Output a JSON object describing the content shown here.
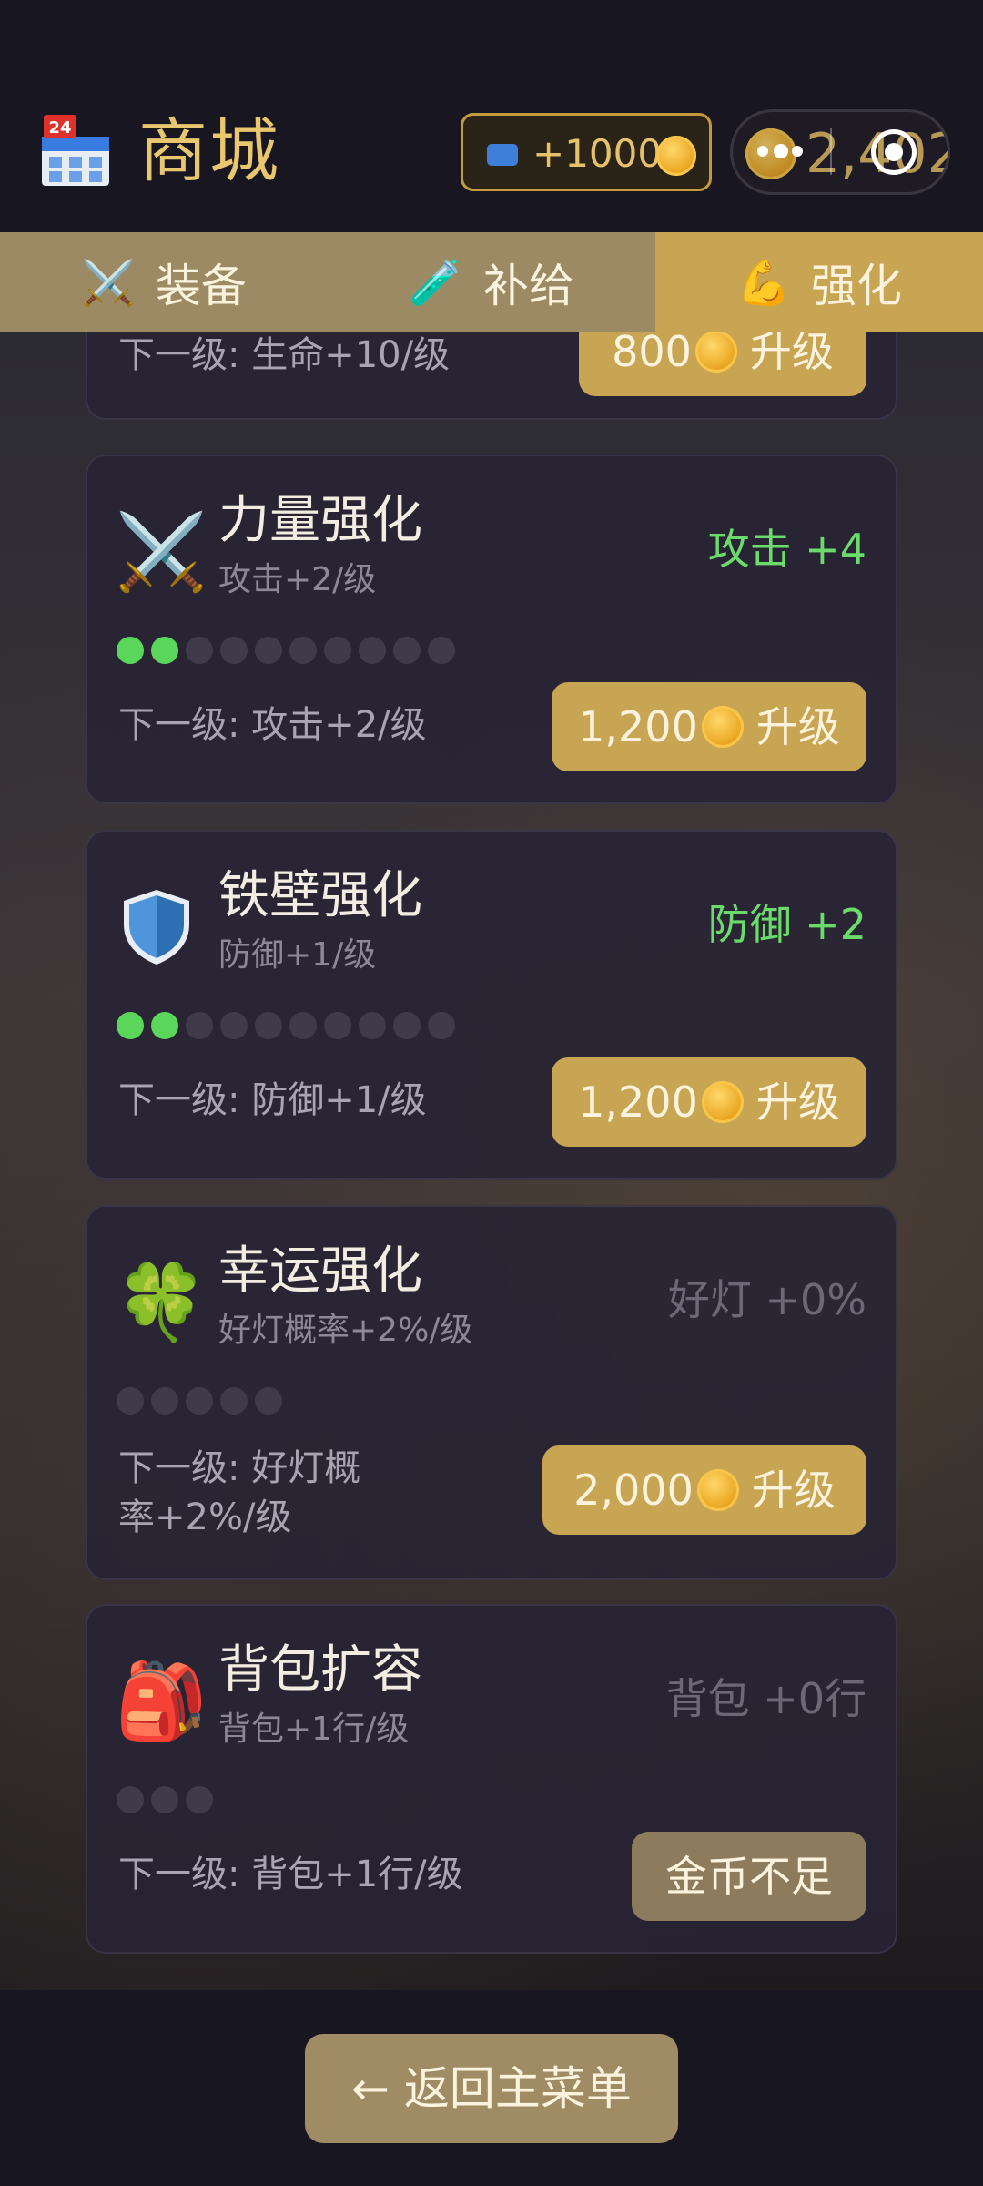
{
  "header": {
    "shop_icon": "convenience-store-icon",
    "title": "商城",
    "ad_reward": "+1000",
    "coins": "2,402"
  },
  "tabs": [
    {
      "icon": "⚔️",
      "label": "装备",
      "active": false
    },
    {
      "icon": "🧪",
      "label": "补给",
      "active": false
    },
    {
      "icon": "💪",
      "label": "强化",
      "active": true
    }
  ],
  "partial_card": {
    "next": "下一级: 生命+10/级",
    "price": "800",
    "action": "升级"
  },
  "cards": [
    {
      "icon": "⚔️",
      "name": "力量强化",
      "sub": "攻击+2/级",
      "stat": "攻击 +4",
      "stat_color": "#6bdc6b",
      "level": 2,
      "max_level": 10,
      "next": "下一级: 攻击+2/级",
      "price": "1,200",
      "action": "升级"
    },
    {
      "icon": "shield-icon",
      "name": "铁壁强化",
      "sub": "防御+1/级",
      "stat": "防御 +2",
      "stat_color": "#6bdc6b",
      "level": 2,
      "max_level": 10,
      "next": "下一级: 防御+1/级",
      "price": "1,200",
      "action": "升级"
    },
    {
      "icon": "🍀",
      "name": "幸运强化",
      "sub": "好灯概率+2%/级",
      "stat": "好灯 +0%",
      "stat_color": "#6c6878",
      "level": 0,
      "max_level": 5,
      "next": "下一级: 好灯概率+2%/级",
      "price": "2,000",
      "action": "升级"
    },
    {
      "icon": "🎒",
      "name": "背包扩容",
      "sub": "背包+1行/级",
      "stat": "背包 +0行",
      "stat_color": "#6c6878",
      "level": 0,
      "max_level": 3,
      "next": "下一级: 背包+1行/级",
      "action": "金币不足"
    }
  ],
  "footer": {
    "back_label": "← 返回主菜单"
  }
}
